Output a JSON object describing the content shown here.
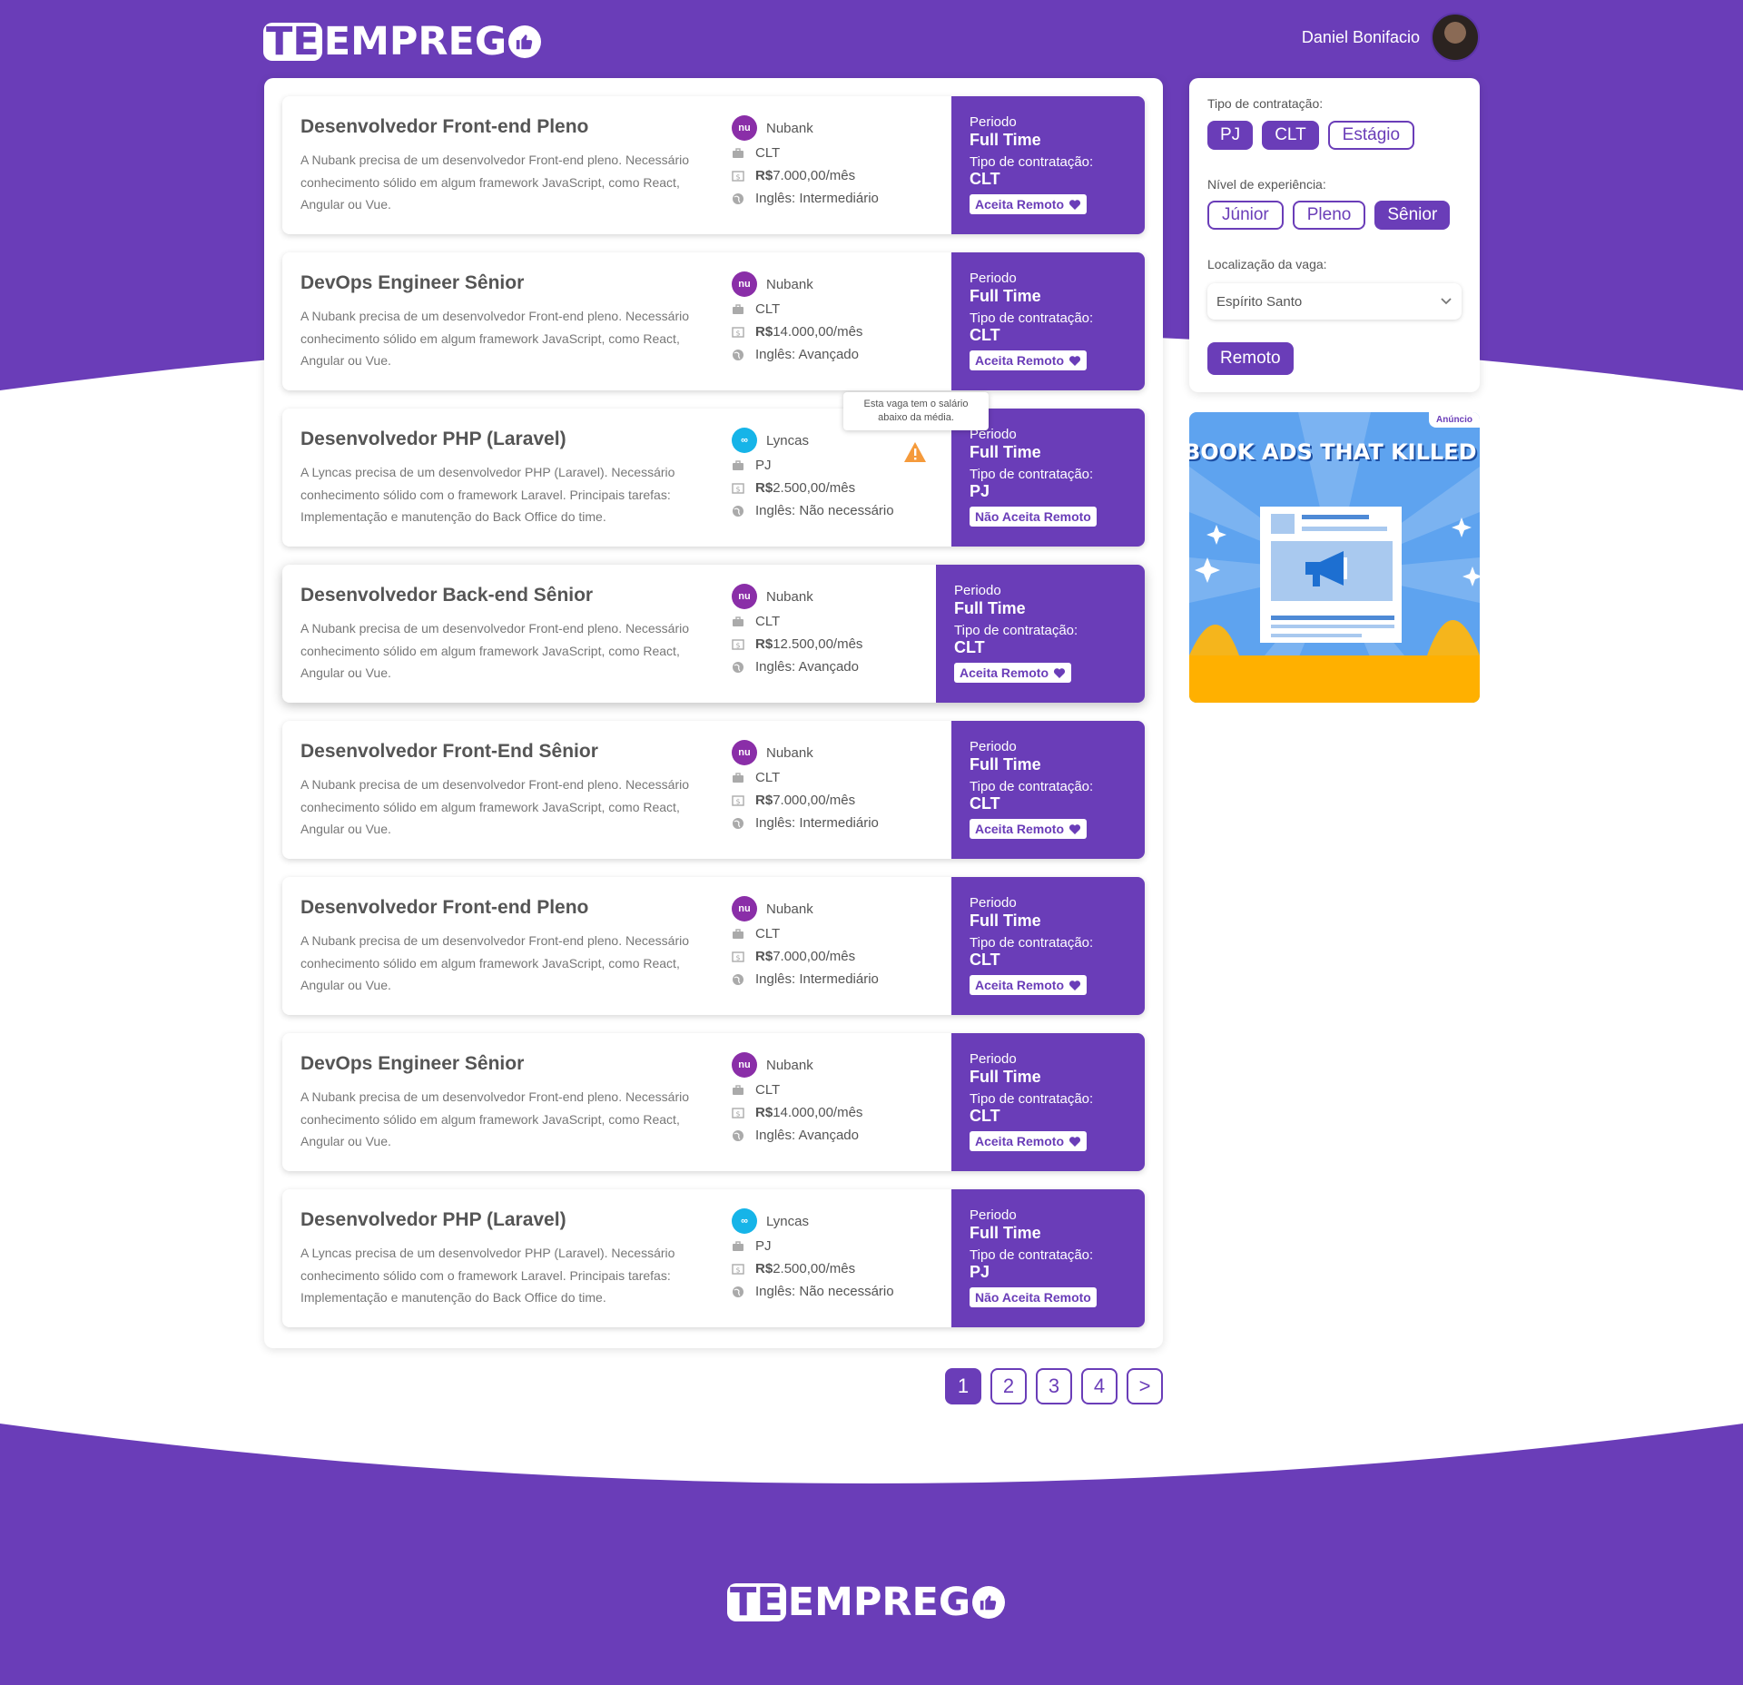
{
  "colors": {
    "brand": "#6a3db8",
    "brand_dark": "#5c35a8",
    "warning": "#f59a3b",
    "nubank": "#8a2ea8",
    "lyncas": "#16b4e8"
  },
  "header": {
    "logo_te": "TE",
    "logo_rest": "EMPREG",
    "user_name": "Daniel Bonifacio"
  },
  "jobs": [
    {
      "title": "Desenvolvedor Front-end Pleno",
      "description": "A Nubank precisa de um desenvolvedor Front-end pleno. Necessário conhecimento sólido em algum framework JavaScript, como React, Angular ou Vue.",
      "company": "Nubank",
      "contract": "CLT",
      "salary_prefix": "R$",
      "salary": "7.000,00/mês",
      "english": "Inglês: Intermediário",
      "period_label": "Periodo",
      "period": "Full Time",
      "contract_label": "Tipo de contratação:",
      "contract_value": "CLT",
      "remote": "Aceita Remoto"
    },
    {
      "title": "DevOps Engineer Sênior",
      "description": "A Nubank precisa de um desenvolvedor Front-end pleno. Necessário conhecimento sólido em algum framework JavaScript, como React, Angular ou Vue.",
      "company": "Nubank",
      "contract": "CLT",
      "salary_prefix": "R$",
      "salary": "14.000,00/mês",
      "english": "Inglês: Avançado",
      "period_label": "Periodo",
      "period": "Full Time",
      "contract_label": "Tipo de contratação:",
      "contract_value": "CLT",
      "remote": "Aceita Remoto"
    },
    {
      "title": "Desenvolvedor PHP (Laravel)",
      "description": "A Lyncas  precisa de um desenvolvedor PHP (Laravel). Necessário conhecimento sólido com o framework Laravel. Principais tarefas: Implementação e manutenção do Back Office do time.",
      "company": "Lyncas",
      "contract": "PJ",
      "salary_prefix": "R$",
      "salary": "2.500,00/mês",
      "english": "Inglês: Não necessário",
      "period_label": "Periodo",
      "period": "Full Time",
      "contract_label": "Tipo de contratação:",
      "contract_value": "PJ",
      "remote": "Não Aceita Remoto"
    },
    {
      "title": "Desenvolvedor Back-end Sênior",
      "description": "A Nubank precisa de um desenvolvedor Front-end pleno. Necessário conhecimento sólido em algum framework JavaScript, como React, Angular ou Vue.",
      "company": "Nubank",
      "contract": "CLT",
      "salary_prefix": "R$",
      "salary": "12.500,00/mês",
      "english": "Inglês: Avançado",
      "period_label": "Periodo",
      "period": "Full Time",
      "contract_label": "Tipo de contratação:",
      "contract_value": "CLT",
      "remote": "Aceita Remoto"
    },
    {
      "title": "Desenvolvedor Front-End Sênior",
      "description": "A Nubank precisa de um desenvolvedor Front-end pleno. Necessário conhecimento sólido em algum framework JavaScript, como React, Angular ou Vue.",
      "company": "Nubank",
      "contract": "CLT",
      "salary_prefix": "R$",
      "salary": "7.000,00/mês",
      "english": "Inglês: Intermediário",
      "period_label": "Periodo",
      "period": "Full Time",
      "contract_label": "Tipo de contratação:",
      "contract_value": "CLT",
      "remote": "Aceita Remoto"
    },
    {
      "title": "Desenvolvedor Front-end Pleno",
      "description": "A Nubank precisa de um desenvolvedor Front-end pleno. Necessário conhecimento sólido em algum framework JavaScript, como React, Angular ou Vue.",
      "company": "Nubank",
      "contract": "CLT",
      "salary_prefix": "R$",
      "salary": "7.000,00/mês",
      "english": "Inglês: Intermediário",
      "period_label": "Periodo",
      "period": "Full Time",
      "contract_label": "Tipo de contratação:",
      "contract_value": "CLT",
      "remote": "Aceita Remoto"
    },
    {
      "title": "DevOps Engineer Sênior",
      "description": "A Nubank precisa de um desenvolvedor Front-end pleno. Necessário conhecimento sólido em algum framework JavaScript, como React, Angular ou Vue.",
      "company": "Nubank",
      "contract": "CLT",
      "salary_prefix": "R$",
      "salary": "14.000,00/mês",
      "english": "Inglês: Avançado",
      "period_label": "Periodo",
      "period": "Full Time",
      "contract_label": "Tipo de contratação:",
      "contract_value": "CLT",
      "remote": "Aceita Remoto"
    },
    {
      "title": "Desenvolvedor PHP (Laravel)",
      "description": "A Lyncas  precisa de um desenvolvedor PHP (Laravel). Necessário conhecimento sólido com o framework Laravel. Principais tarefas: Implementação e manutenção do Back Office do time.",
      "company": "Lyncas",
      "contract": "PJ",
      "salary_prefix": "R$",
      "salary": "2.500,00/mês",
      "english": "Inglês: Não necessário",
      "period_label": "Periodo",
      "period": "Full Time",
      "contract_label": "Tipo de contratação:",
      "contract_value": "PJ",
      "remote": "Não Aceita Remoto"
    }
  ],
  "tooltip": {
    "line1": "Esta vaga tem o salário",
    "line2": "abaixo da média."
  },
  "filters": {
    "contract_label": "Tipo de contratação:",
    "contract_options": [
      {
        "label": "PJ",
        "selected": true
      },
      {
        "label": "CLT",
        "selected": true
      },
      {
        "label": "Estágio",
        "selected": false
      }
    ],
    "level_label": "Nível de experiência:",
    "level_options": [
      {
        "label": "Júnior",
        "selected": false
      },
      {
        "label": "Pleno",
        "selected": false
      },
      {
        "label": "Sênior",
        "selected": true
      }
    ],
    "location_label": "Localização da vaga:",
    "location_value": "Espírito Santo",
    "remote_label": "Remoto"
  },
  "ad": {
    "badge": "Anúncio",
    "headline": "BOOK ADS THAT KILLED IT IN"
  },
  "pagination": {
    "pages": [
      "1",
      "2",
      "3",
      "4"
    ],
    "current": "1",
    "next": ">"
  },
  "footer": {
    "logo_te": "TE",
    "logo_rest": "EMPREG"
  }
}
